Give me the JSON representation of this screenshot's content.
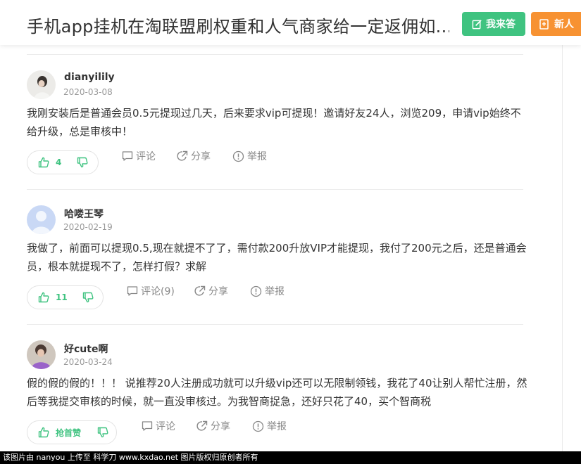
{
  "header": {
    "title": "手机app挂机在淘联盟刷权重和人气商家给一定返佣如...",
    "answer_label": "我来答",
    "newuser_label": "新人",
    "colors": {
      "answer": "#3fc380",
      "newuser": "#f79232"
    }
  },
  "answers": [
    {
      "user": "dianyilily",
      "date": "2020-03-08",
      "text": "我刚安装后是普通会员0.5元提现过几天，后来要求vip可提现！邀请好友24人，浏览209，申请vip始终不给升级，总是审核中！",
      "likes": "4",
      "comment_label": "评论",
      "share_label": "分享",
      "report_label": "举报"
    },
    {
      "user": "哈喽王琴",
      "date": "2020-02-19",
      "text": "我做了，前面可以提现0.5,现在就提不了了，需付款200升放VIP才能提现，我付了200元之后，还是普通会员，根本就提现不了，怎样打假？求解",
      "likes": "11",
      "comment_label": "评论(9)",
      "share_label": "分享",
      "report_label": "举报"
    },
    {
      "user": "好cute啊",
      "date": "2020-03-24",
      "text": "假的假的假的！！！ 说推荐20人注册成功就可以升级vip还可以无限制领钱，我花了40让别人帮忙注册，然后等我提交审核的时候，就一直没审核过。为我智商捉急，还好只花了40，买个智商税",
      "likes": "抢首赞",
      "comment_label": "评论",
      "share_label": "分享",
      "report_label": "举报"
    }
  ],
  "footer": {
    "text": "该图片由 nanyou 上传至 科学刀 www.kxdao.net 图片版权归原创者所有"
  }
}
